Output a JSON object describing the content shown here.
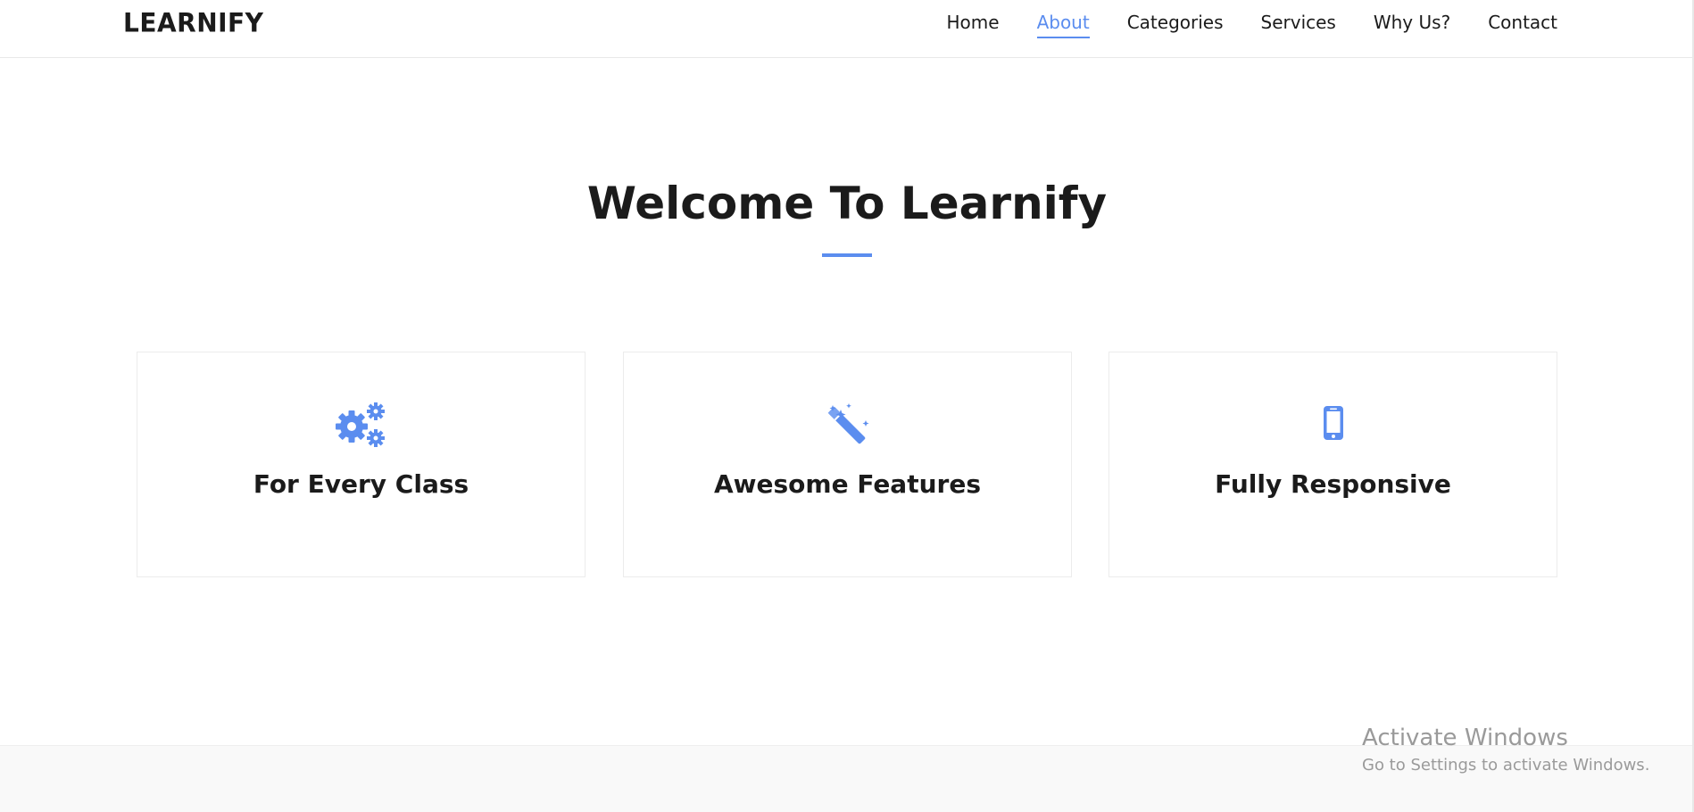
{
  "header": {
    "logo": "LEARNIFY",
    "nav": [
      {
        "label": "Home",
        "active": false
      },
      {
        "label": "About",
        "active": true
      },
      {
        "label": "Categories",
        "active": false
      },
      {
        "label": "Services",
        "active": false
      },
      {
        "label": "Why Us?",
        "active": false
      },
      {
        "label": "Contact",
        "active": false
      }
    ]
  },
  "main": {
    "title": "Welcome To Learnify",
    "cards": [
      {
        "icon": "gears-icon",
        "title": "For Every Class"
      },
      {
        "icon": "magic-wand-icon",
        "title": "Awesome Features"
      },
      {
        "icon": "mobile-phone-icon",
        "title": "Fully Responsive"
      }
    ]
  },
  "watermark": {
    "title": "Activate Windows",
    "subtitle": "Go to Settings to activate Windows."
  },
  "colors": {
    "accent": "#5b8def",
    "text": "#1b1b1b",
    "border": "#ececec",
    "footer_bg": "#f9f9f9"
  }
}
